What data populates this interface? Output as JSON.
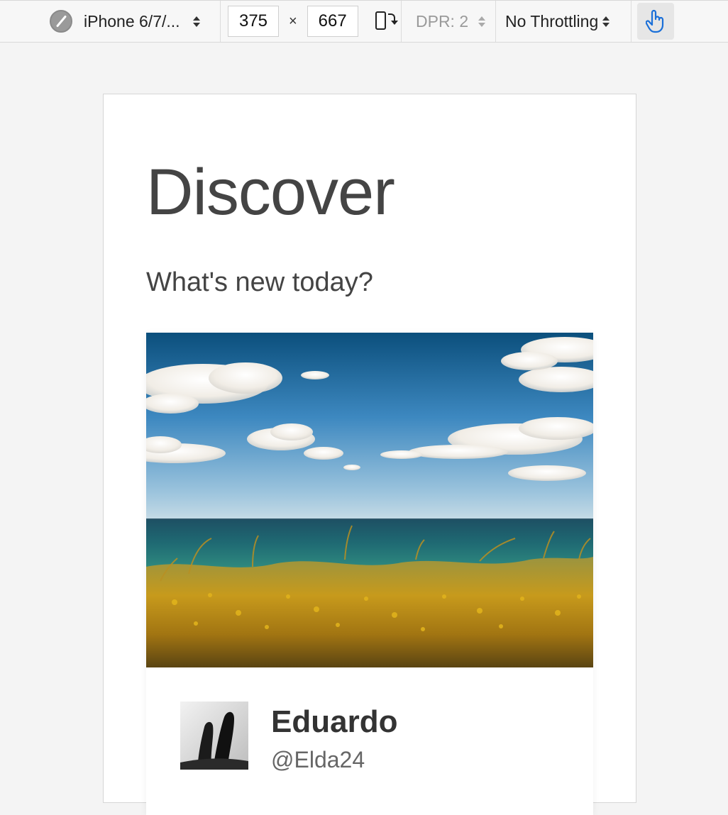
{
  "toolbar": {
    "device_icon": "compass-icon",
    "device_name": "iPhone 6/7/...",
    "width_value": "375",
    "times_symbol": "×",
    "height_value": "667",
    "rotate_icon": "rotate-device-icon",
    "dpr_label": "DPR: 2",
    "throttling_label": "No Throttling",
    "touch_icon": "touch-hand-icon",
    "touch_active_color": "#1a6fd8"
  },
  "page": {
    "title": "Discover",
    "subtitle": "What's new today?"
  },
  "card": {
    "image_description_icon": "photo-icon",
    "author": {
      "avatar_icon": "avatar-feet-photo",
      "name": "Eduardo",
      "handle": "@Elda24"
    }
  }
}
